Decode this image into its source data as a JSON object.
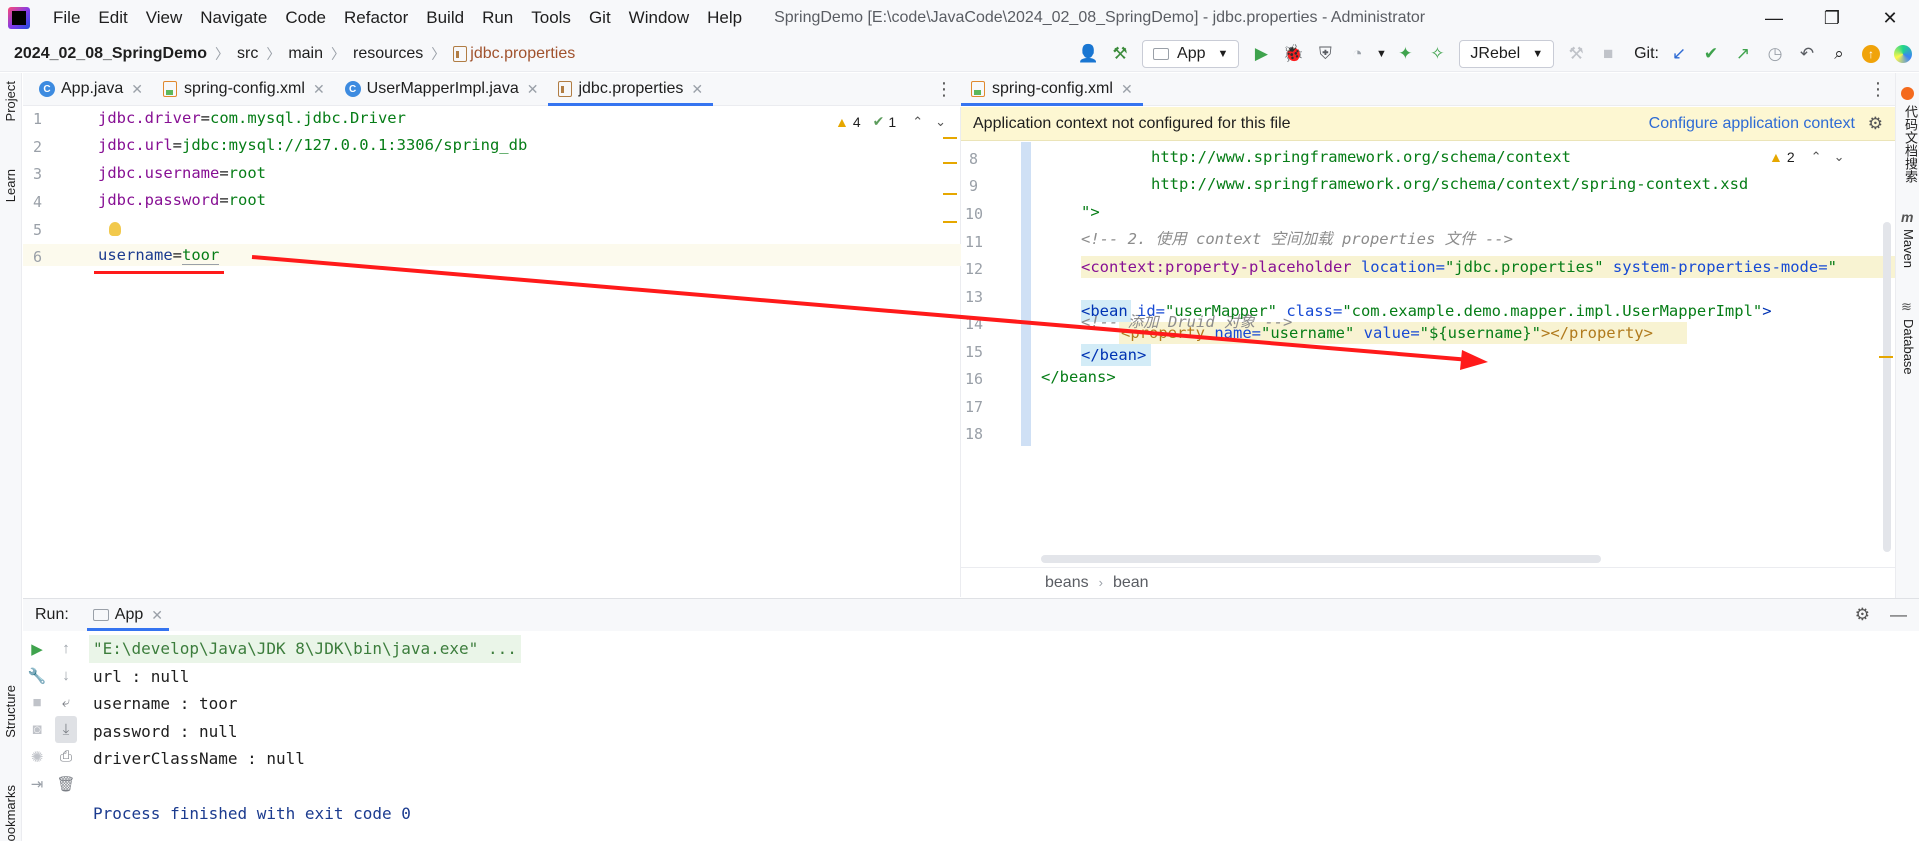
{
  "window": {
    "menu": [
      "File",
      "Edit",
      "View",
      "Navigate",
      "Code",
      "Refactor",
      "Build",
      "Run",
      "Tools",
      "Git",
      "Window",
      "Help"
    ],
    "title": "SpringDemo [E:\\code\\JavaCode\\2024_02_08_SpringDemo] - jdbc.properties - Administrator",
    "controls": {
      "minimize": "—",
      "restore": "❐",
      "close": "✕"
    }
  },
  "breadcrumb": {
    "project": "2024_02_08_SpringDemo",
    "parts": [
      "src",
      "main",
      "resources"
    ],
    "file": "jdbc.properties"
  },
  "toolbar": {
    "run_config": "App",
    "jrebel": "JRebel",
    "git_label": "Git:"
  },
  "left_stripe": {
    "project": "Project",
    "learn": "Learn",
    "structure": "Structure",
    "bookmarks": "Bookmarks"
  },
  "right_stripe": {
    "code_search": "代码文档搜索",
    "maven": "Maven",
    "database": "Database"
  },
  "left_tabs": [
    {
      "label": "App.java",
      "icon": "class"
    },
    {
      "label": "spring-config.xml",
      "icon": "xml"
    },
    {
      "label": "UserMapperImpl.java",
      "icon": "class"
    },
    {
      "label": "jdbc.properties",
      "icon": "properties",
      "active": true
    }
  ],
  "right_tabs": [
    {
      "label": "spring-config.xml",
      "icon": "xml",
      "active": true
    }
  ],
  "left_editor": {
    "inspections": {
      "warnings": "4",
      "weak_warnings": "1"
    },
    "lines": [
      {
        "num": "1",
        "key": "jdbc.driver",
        "value": "com.mysql.jdbc.Driver"
      },
      {
        "num": "2",
        "key": "jdbc.url",
        "value": "jdbc:mysql://127.0.0.1:3306/spring_db"
      },
      {
        "num": "3",
        "key": "jdbc.username",
        "value": "root"
      },
      {
        "num": "4",
        "key": "jdbc.password",
        "value": "root"
      },
      {
        "num": "5",
        "key": "",
        "value": ""
      },
      {
        "num": "6",
        "key": "username",
        "value": "toor"
      }
    ]
  },
  "right_editor": {
    "banner_text": "Application context not configured for this file",
    "banner_link": "Configure application context",
    "inspections": {
      "warnings": "2"
    },
    "line_numbers": [
      "8",
      "9",
      "10",
      "11",
      "12",
      "13",
      "14",
      "15",
      "16",
      "17",
      "18"
    ],
    "code": {
      "l8": "http://www.springframework.org/schema/context",
      "l9": "http://www.springframework.org/schema/context/spring-context.xsd",
      "l10": "\">",
      "l11": "<!-- 2. 使用 context 空间加载 properties 文件 -->",
      "l12_tag": "<context:property-placeholder",
      "l12_attr1": " location=",
      "l12_val1": "\"jdbc.properties\"",
      "l12_attr2": " system-properties-mode=",
      "l12_val2": "\"",
      "l14": "<!-- 添加 Druid 对象 -->",
      "l15_tag": "<bean",
      "l15_attr1": " id=",
      "l15_val1": "\"userMapper\"",
      "l15_attr2": " class=",
      "l15_val2": "\"com.example.demo.mapper.impl.UserMapperImpl\"",
      "l15_end": ">",
      "l16_tag": "<property",
      "l16_attr1": " name=",
      "l16_val1": "\"username\"",
      "l16_attr2": " value=",
      "l16_val2": "\"${username}\"",
      "l16_end": "></property>",
      "l17": "</bean>",
      "l18": "</beans>"
    },
    "breadcrumb": [
      "beans",
      "bean"
    ]
  },
  "run_panel": {
    "label": "Run:",
    "tab": "App",
    "console": [
      "\"E:\\develop\\Java\\JDK 8\\JDK\\bin\\java.exe\" ...",
      "url : null",
      "username : toor",
      "password : null",
      "driverClassName : null",
      "",
      "Process finished with exit code 0"
    ]
  },
  "colors": {
    "accent": "#3574f0",
    "annotation": "#ff1a1a",
    "banner": "#fdf7d2"
  }
}
